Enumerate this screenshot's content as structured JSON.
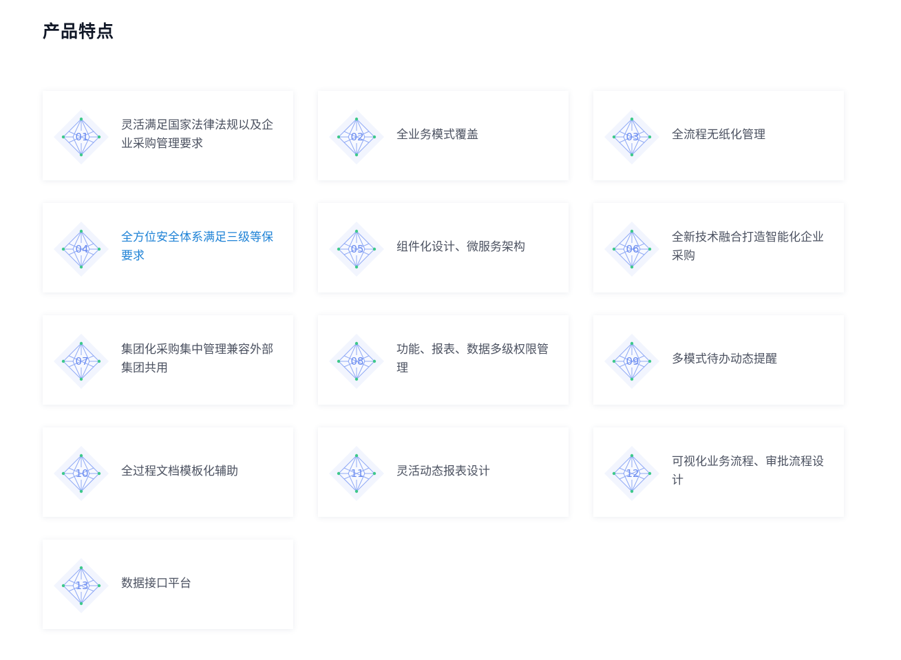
{
  "section": {
    "title": "产品特点"
  },
  "features": [
    {
      "num": "01",
      "text": "灵活满足国家法律法规以及企业采购管理要求"
    },
    {
      "num": "02",
      "text": "全业务模式覆盖"
    },
    {
      "num": "03",
      "text": "全流程无纸化管理"
    },
    {
      "num": "04",
      "text": "全方位安全体系满足三级等保要求",
      "active": true
    },
    {
      "num": "05",
      "text": "组件化设计、微服务架构"
    },
    {
      "num": "06",
      "text": "全新技术融合打造智能化企业采购"
    },
    {
      "num": "07",
      "text": "集团化采购集中管理兼容外部集团共用"
    },
    {
      "num": "08",
      "text": "功能、报表、数据多级权限管理"
    },
    {
      "num": "09",
      "text": "多模式待办动态提醒"
    },
    {
      "num": "10",
      "text": "全过程文档模板化辅助"
    },
    {
      "num": "11",
      "text": "灵活动态报表设计"
    },
    {
      "num": "12",
      "text": "可视化业务流程、审批流程设计"
    },
    {
      "num": "13",
      "text": "数据接口平台"
    }
  ],
  "colors": {
    "title": "#111827",
    "text": "#4b5160",
    "active_text": "#1e82d6",
    "icon_line": "#8fa9f5",
    "icon_node": "#3ec98a",
    "icon_number": "#6b8cf0",
    "icon_bg": "#eef2fd"
  },
  "icon": {
    "name": "diamond-network-icon"
  }
}
